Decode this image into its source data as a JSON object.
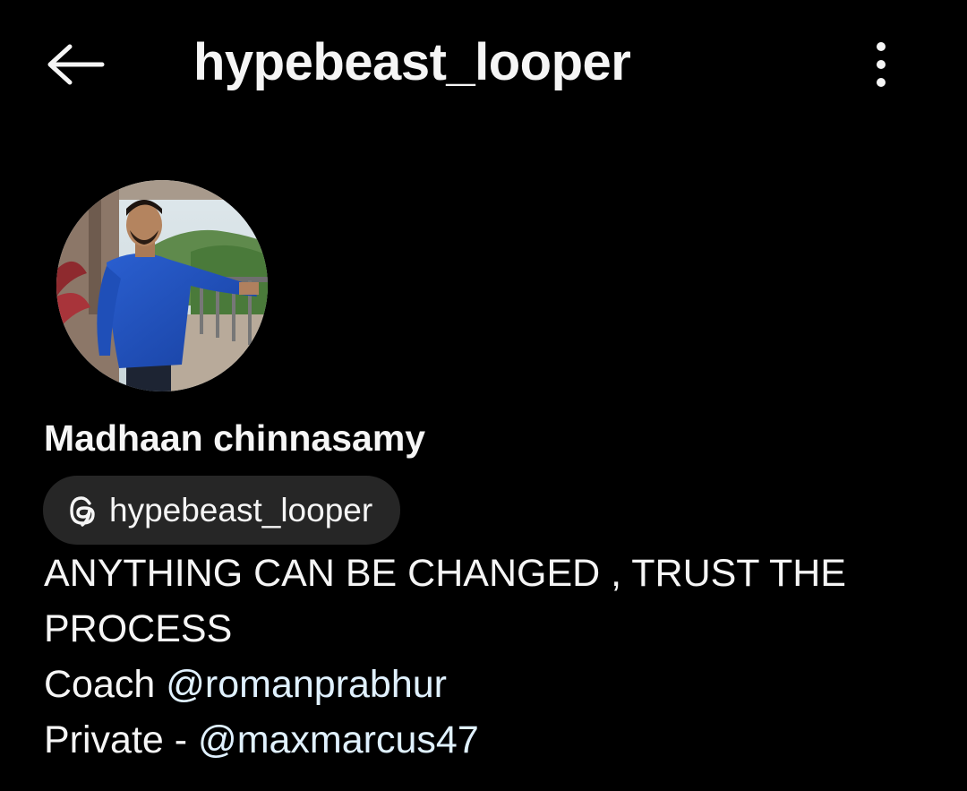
{
  "header": {
    "back_icon": "arrow-left-icon",
    "title": "hypebeast_looper",
    "more_icon": "more-vertical-icon"
  },
  "profile": {
    "avatar_icon": "profile-photo",
    "display_name": "Madhaan chinnasamy",
    "threads_icon": "threads-icon",
    "threads_handle": "hypebeast_looper"
  },
  "bio": {
    "line1": "ANYTHING CAN BE CHANGED , TRUST THE",
    "line2": "PROCESS",
    "line3_prefix": "Coach ",
    "line3_mention": "@romanprabhur",
    "line4_prefix": "Private - ",
    "line4_mention": "@maxmarcus47"
  },
  "colors": {
    "background": "#000000",
    "text": "#f5f5f5",
    "pill_background": "#262626",
    "mention": "#e0f1ff"
  }
}
